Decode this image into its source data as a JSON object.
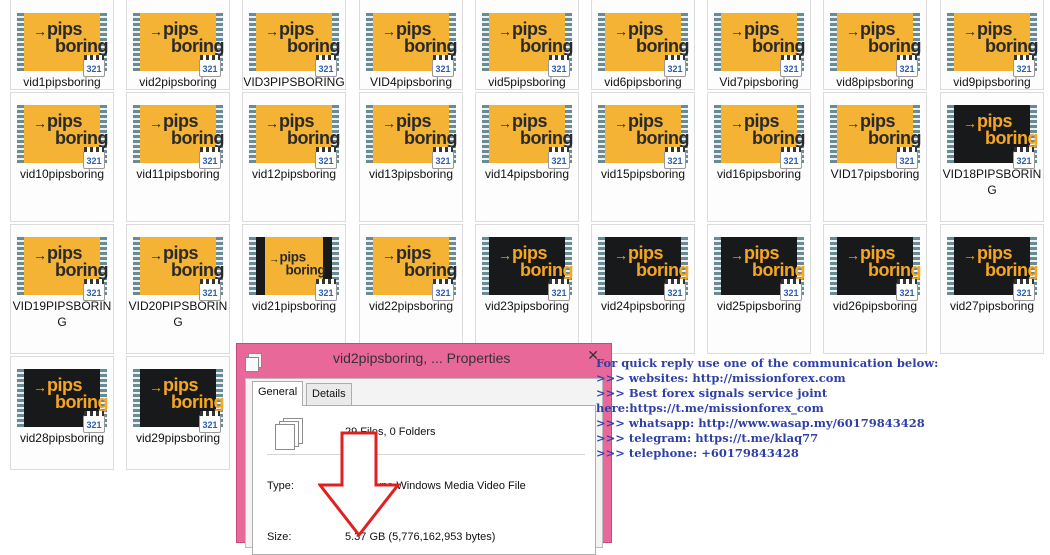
{
  "files": [
    {
      "name": "vid1pipsboring",
      "thumb": "yellow"
    },
    {
      "name": "vid2pipsboring",
      "thumb": "yellow"
    },
    {
      "name": "VID3PIPSBORING",
      "thumb": "yellow"
    },
    {
      "name": "VID4pipsboring",
      "thumb": "yellow"
    },
    {
      "name": "vid5pipsboring",
      "thumb": "yellow"
    },
    {
      "name": "vid6pipsboring",
      "thumb": "yellow"
    },
    {
      "name": "Vid7pipsboring",
      "thumb": "yellow"
    },
    {
      "name": "vid8pipsboring",
      "thumb": "yellow"
    },
    {
      "name": "vid9pipsboring",
      "thumb": "yellow"
    },
    {
      "name": "vid10pipsboring",
      "thumb": "yellow"
    },
    {
      "name": "vid11pipsboring",
      "thumb": "yellow"
    },
    {
      "name": "vid12pipsboring",
      "thumb": "yellow"
    },
    {
      "name": "vid13pipsboring",
      "thumb": "yellow"
    },
    {
      "name": "vid14pipsboring",
      "thumb": "yellow"
    },
    {
      "name": "vid15pipsboring",
      "thumb": "yellow"
    },
    {
      "name": "vid16pipsboring",
      "thumb": "yellow"
    },
    {
      "name": "VID17pipsboring",
      "thumb": "yellow"
    },
    {
      "name": "VID18PIPSBORING",
      "thumb": "dark"
    },
    {
      "name": "VID19PIPSBORING",
      "thumb": "yellow"
    },
    {
      "name": "VID20PIPSBORING",
      "thumb": "yellow"
    },
    {
      "name": "vid21pipsboring",
      "thumb": "letterbox"
    },
    {
      "name": "vid22pipsboring",
      "thumb": "yellow"
    },
    {
      "name": "vid23pipsboring",
      "thumb": "dark"
    },
    {
      "name": "vid24pipsboring",
      "thumb": "dark"
    },
    {
      "name": "vid25pipsboring",
      "thumb": "dark"
    },
    {
      "name": "vid26pipsboring",
      "thumb": "dark"
    },
    {
      "name": "vid27pipsboring",
      "thumb": "dark"
    },
    {
      "name": "vid28pipsboring",
      "thumb": "dark"
    },
    {
      "name": "vid29pipsboring",
      "thumb": "dark"
    }
  ],
  "thumbnail": {
    "logo_top": "pips",
    "logo_bottom": "boring",
    "badge": "321",
    "colors": {
      "yellow": "#f5b335",
      "dark": "#18191b",
      "logo_dark_text": "#f5a623"
    }
  },
  "dialog": {
    "title": "vid2pipsboring, ... Properties",
    "close": "✕",
    "tabs": [
      {
        "label": "General",
        "active": true
      },
      {
        "label": "Details",
        "active": false
      }
    ],
    "summary": "29 Files, 0 Folders",
    "type_label": "Type:",
    "type_value": "All of type Windows Media Video File",
    "size_label": "Size:",
    "size_value": "5.37 GB (5,776,162,953 bytes)",
    "titlebar_color": "#e9689a"
  },
  "contact": {
    "lines": [
      "For quick reply use one of the communication below:",
      ">>>  websites: http://missionforex.com",
      ">>>  Best forex signals service joint",
      "here:https://t.me/missionforex_com",
      ">>>  whatsapp: http://www.wasap.my/60179843428",
      ">>>  telegram: https://t.me/klaq77",
      ">>>  telephone: +60179843428"
    ],
    "color": "#2e3fa8"
  },
  "annotation": {
    "arrow_color": "#e02020"
  }
}
